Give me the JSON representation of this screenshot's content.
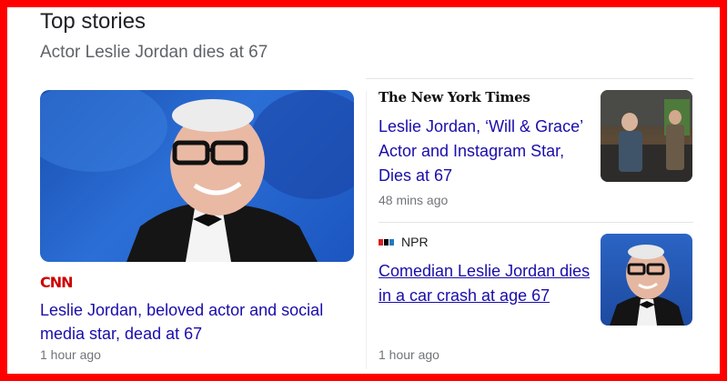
{
  "section": {
    "title": "Top stories",
    "subtitle": "Actor Leslie Jordan dies at 67"
  },
  "stories": [
    {
      "source": "CNN",
      "headline": "Leslie Jordan, beloved actor and social media star, dead at 67",
      "time": "1 hour ago"
    },
    {
      "source": "The New York Times",
      "headline": "Leslie Jordan, ‘Will & Grace’ Actor and Instagram Star, Dies at 67",
      "time": "48 mins ago"
    },
    {
      "source": "NPR",
      "headline": "Comedian Leslie Jordan dies in a car crash at age 67",
      "time": "1 hour ago"
    }
  ],
  "colors": {
    "frame": "#ff0000",
    "link": "#1a0dab",
    "cnn": "#cc0000"
  },
  "icons": {
    "npr_logo": "npr-logo-icon"
  }
}
